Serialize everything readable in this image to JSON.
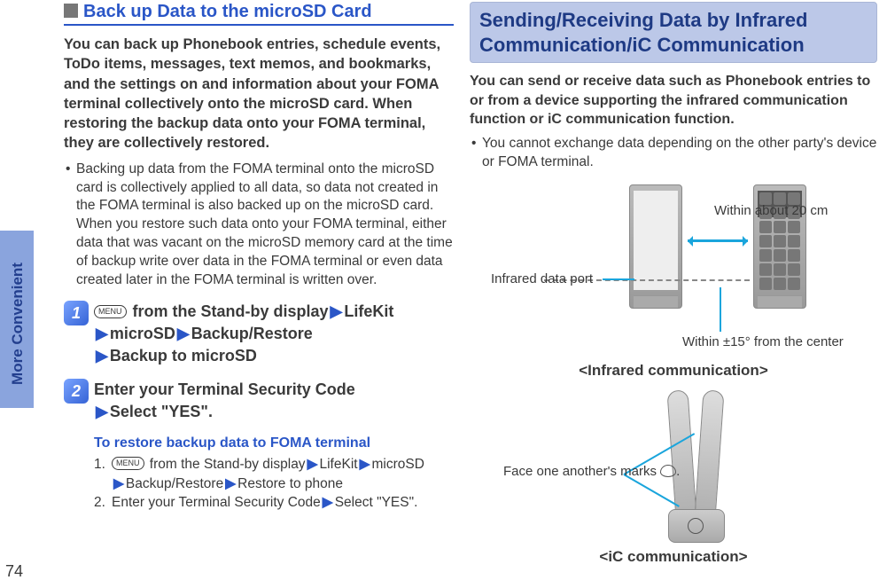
{
  "page_number": "74",
  "side_tab": "More Convenient",
  "left": {
    "heading": "Back up Data to the microSD Card",
    "intro": "You can back up Phonebook entries, schedule events, ToDo items, messages, text memos, and bookmarks, and the settings on and information about your FOMA terminal collectively onto the microSD card. When restoring the backup data onto your FOMA terminal, they are collectively restored.",
    "bullet1": "Backing up data from the FOMA terminal onto the microSD card is collectively applied to all data, so data not created in the FOMA terminal is also backed up on the microSD card. When you restore such data onto your FOMA terminal, either data that was vacant on the microSD memory card at the time of backup write over data in the FOMA terminal or even data created later in the FOMA terminal is written over.",
    "step1": {
      "num": "1",
      "menu_key": "MENU",
      "text_a": " from the Stand-by display",
      "seg1": "LifeKit",
      "seg2": "microSD",
      "seg3": "Backup/Restore",
      "seg4": "Backup to microSD"
    },
    "step2": {
      "num": "2",
      "line1": "Enter your Terminal Security Code",
      "seg": "Select \"YES\"."
    },
    "restore_header": "To restore backup data to FOMA terminal",
    "restore": {
      "n1": "1.",
      "menu_key": "MENU",
      "r1_a": " from the Stand-by display",
      "r1_s1": "LifeKit",
      "r1_s2": "microSD",
      "r1_s3": "Backup/Restore",
      "r1_s4": "Restore to phone",
      "n2": "2.",
      "r2_a": "Enter your Terminal Security Code",
      "r2_s": "Select \"YES\"."
    }
  },
  "right": {
    "section_title": "Sending/Receiving Data by Infrared Communication/iC Communication",
    "intro": "You can send or receive data such as Phonebook entries to or from a device supporting the infrared communication function or iC communication function.",
    "bullet": "You cannot exchange data depending on the other party's device or FOMA terminal.",
    "ir": {
      "port_label": "Infrared data port",
      "distance": "Within about 20 cm",
      "angle": "Within ±15° from the center",
      "caption": "<Infrared communication>"
    },
    "ic": {
      "face_label_a": "Face one another's marks ",
      "face_label_b": ".",
      "caption": "<iC communication>"
    }
  }
}
